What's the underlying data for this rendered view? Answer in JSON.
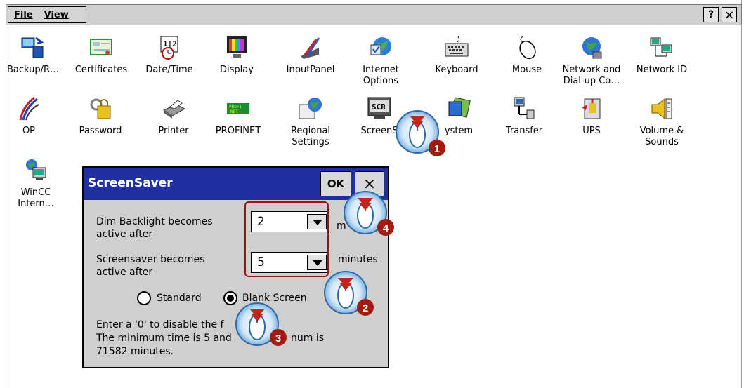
{
  "menu": {
    "file": "File",
    "view": "View",
    "help": "?",
    "close": "×"
  },
  "icons": [
    {
      "label": "Backup/R…",
      "icon": "backup-icon"
    },
    {
      "label": "Certificates",
      "icon": "certificate-icon"
    },
    {
      "label": "Date/Time",
      "icon": "calendar-clock-icon"
    },
    {
      "label": "Display",
      "icon": "monitor-icon"
    },
    {
      "label": "InputPanel",
      "icon": "input-panel-icon"
    },
    {
      "label": "Internet Options",
      "icon": "internet-options-icon"
    },
    {
      "label": "Keyboard",
      "icon": "keyboard-icon"
    },
    {
      "label": "Mouse",
      "icon": "mouse-icon"
    },
    {
      "label": "Network and Dial-up Co…",
      "icon": "network-dialup-icon"
    },
    {
      "label": "Network ID",
      "icon": "network-id-icon"
    },
    {
      "label": "OP",
      "icon": "op-icon"
    },
    {
      "label": "Password",
      "icon": "password-icon"
    },
    {
      "label": "Printer",
      "icon": "printer-icon"
    },
    {
      "label": "PROFINET",
      "icon": "profinet-icon"
    },
    {
      "label": "Regional Settings",
      "icon": "regional-settings-icon"
    },
    {
      "label": "ScreenS",
      "icon": "screensaver-icon"
    },
    {
      "label": "ystem",
      "icon": "system-icon"
    },
    {
      "label": "Transfer",
      "icon": "transfer-icon"
    },
    {
      "label": "UPS",
      "icon": "ups-icon"
    },
    {
      "label": "Volume & Sounds",
      "icon": "volume-icon"
    },
    {
      "label": "WinCC Intern…",
      "icon": "wincc-icon"
    }
  ],
  "dialog": {
    "title": "ScreenSaver",
    "ok": "OK",
    "close": "×",
    "dim_label_1": "Dim Backlight becomes",
    "dim_label_2": "active after",
    "dim_value": "2",
    "dim_unit": "m",
    "saver_label_1": "Screensaver becomes",
    "saver_label_2": "active after",
    "saver_value": "5",
    "saver_unit": "minutes",
    "radio_standard": "Standard",
    "radio_blank": "Blank Screen",
    "selected": "Blank Screen",
    "info_1": "Enter a '0' to disable the f",
    "info_2a": "The minimum time is 5 and",
    "info_2b": "num is",
    "info_3": "71582 minutes."
  },
  "steps": [
    "1",
    "2",
    "3",
    "4"
  ],
  "colors": {
    "title_bar": "#1f2f9f",
    "step_badge": "#a01c12",
    "highlight": "#8b1a1a"
  }
}
